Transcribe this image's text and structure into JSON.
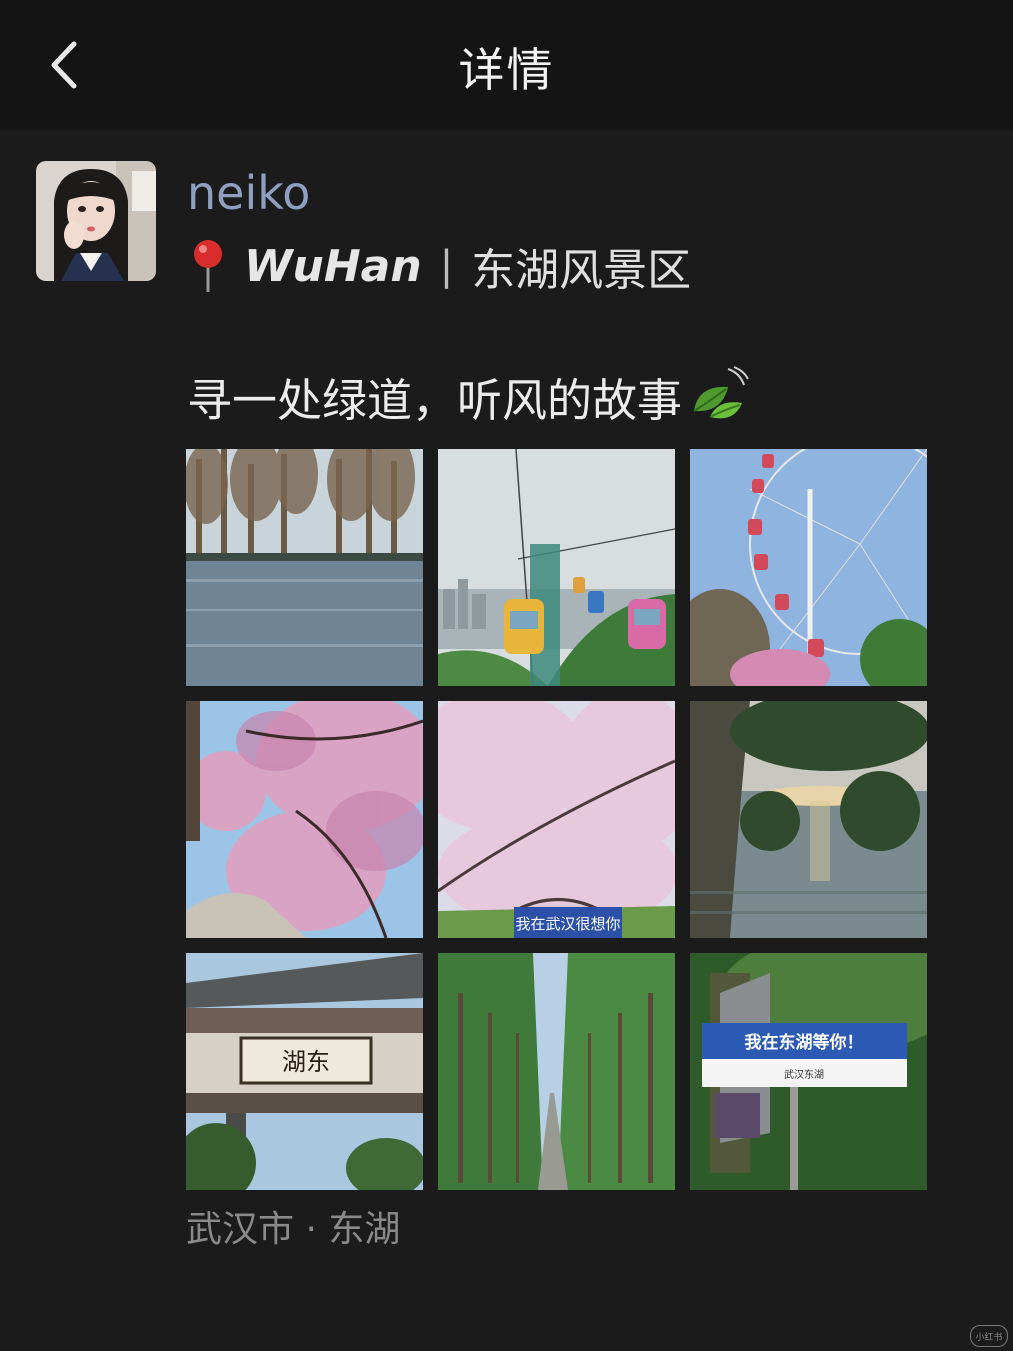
{
  "header": {
    "title": "详情",
    "back_icon": "chevron-left-icon"
  },
  "post": {
    "author": "neiko",
    "location_pin_icon": "round-pushpin-icon",
    "city": "WuHan",
    "separator": "|",
    "place": "东湖风景区",
    "caption": "寻一处绿道，听风的故事",
    "caption_emoji_icon": "leaf-fluttering-in-wind-icon",
    "photos": [
      {
        "name": "photo-lake-trees"
      },
      {
        "name": "photo-cable-cars"
      },
      {
        "name": "photo-ferris-wheel"
      },
      {
        "name": "photo-cherry-blossom-sky"
      },
      {
        "name": "photo-cherry-blossom-sign",
        "sign_text": "我在武汉很想你"
      },
      {
        "name": "photo-lakeside-sunset"
      },
      {
        "name": "photo-east-lake-gate",
        "sign_text": "湖东"
      },
      {
        "name": "photo-tree-lined-road"
      },
      {
        "name": "photo-road-sign",
        "sign_text": "我在东湖等你！",
        "sign_sub": "武汉东湖"
      }
    ],
    "location_tag": "武汉市 · 东湖"
  },
  "watermark": "小红书"
}
